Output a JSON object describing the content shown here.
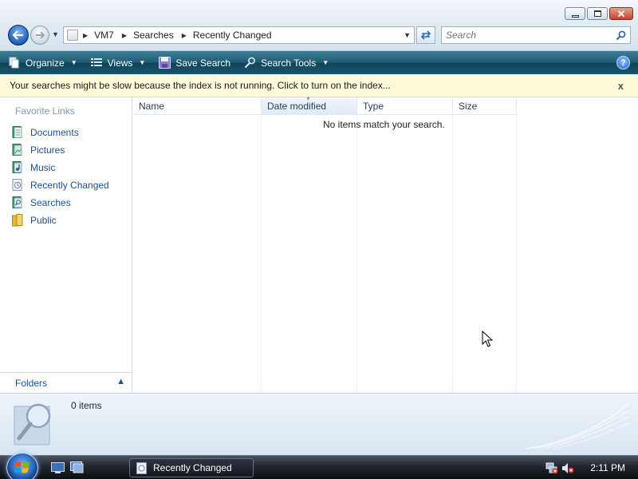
{
  "window": {
    "caption_buttons": {
      "minimize": "minimize",
      "maximize": "maximize",
      "close": "close"
    },
    "address": {
      "crumbs": [
        "VM7",
        "Searches",
        "Recently Changed"
      ]
    },
    "search": {
      "placeholder": "Search"
    }
  },
  "commands": {
    "organize": "Organize",
    "views": "Views",
    "save_search": "Save Search",
    "search_tools": "Search Tools",
    "help": "?"
  },
  "infobar": {
    "message": "Your searches might be slow because the index is not running.  Click to turn on the index...",
    "close": "x"
  },
  "nav": {
    "header": "Favorite Links",
    "items": [
      {
        "label": "Documents",
        "icon": "documents-icon"
      },
      {
        "label": "Pictures",
        "icon": "pictures-icon"
      },
      {
        "label": "Music",
        "icon": "music-icon"
      },
      {
        "label": "Recently Changed",
        "icon": "recently-changed-icon"
      },
      {
        "label": "Searches",
        "icon": "searches-icon"
      },
      {
        "label": "Public",
        "icon": "public-folder-icon"
      }
    ],
    "folders": "Folders"
  },
  "filelist": {
    "columns": [
      "Name",
      "Date modified",
      "Type",
      "Size"
    ],
    "empty_message": "No items match your search."
  },
  "details": {
    "count": "0 items"
  },
  "taskbar": {
    "task": "Recently Changed",
    "clock": "2:11 PM"
  },
  "colors": {
    "link": "#1c4f8f",
    "infobar_bg": "#fefbdb",
    "command_bar": "#1f5a73"
  }
}
